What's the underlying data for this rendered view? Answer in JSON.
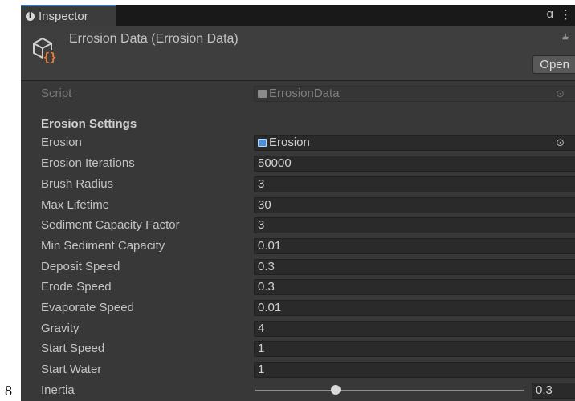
{
  "page_number": "8",
  "tab": {
    "title": "Inspector",
    "icon": "info-icon"
  },
  "tab_tools": {
    "lock_icon": "lock-icon",
    "menu_icon": "kebab-menu-icon",
    "lock_glyph": "ɑ",
    "menu_glyph": "⋮"
  },
  "header": {
    "title": "Errosion Data (Errosion Data)",
    "icon": "scriptable-object-icon",
    "settings_glyph": "⫩",
    "open_label": "Open"
  },
  "script_field": {
    "label": "Script",
    "value": "ErrosionData",
    "picker_glyph": "⊙"
  },
  "section_header": "Erosion Settings",
  "erosion_field": {
    "label": "Erosion",
    "value": "Erosion",
    "picker_glyph": "⊙"
  },
  "fields": [
    {
      "label": "Erosion Iterations",
      "value": "50000"
    },
    {
      "label": "Brush Radius",
      "value": "3"
    },
    {
      "label": "Max Lifetime",
      "value": "30"
    },
    {
      "label": "Sediment Capacity Factor",
      "value": "3"
    },
    {
      "label": "Min Sediment Capacity",
      "value": "0.01"
    },
    {
      "label": "Deposit Speed",
      "value": "0.3"
    },
    {
      "label": "Erode Speed",
      "value": "0.3"
    },
    {
      "label": "Evaporate Speed",
      "value": "0.01"
    },
    {
      "label": "Gravity",
      "value": "4"
    },
    {
      "label": "Start Speed",
      "value": "1"
    },
    {
      "label": "Start Water",
      "value": "1"
    }
  ],
  "inertia": {
    "label": "Inertia",
    "value": "0.3",
    "fraction": 0.3
  },
  "colors": {
    "accent": "#3a79bb",
    "panel": "#383838",
    "field": "#2a2a2a"
  }
}
